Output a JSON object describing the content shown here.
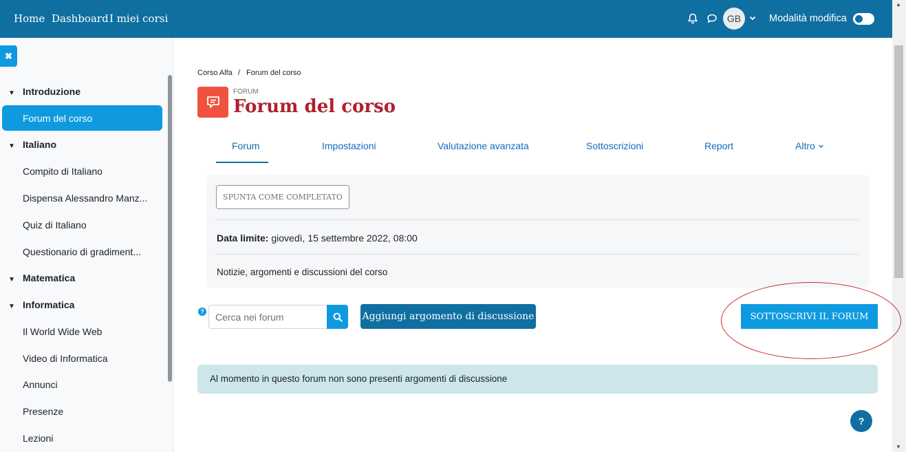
{
  "navbar": {
    "links": [
      "Home",
      "Dashboard",
      "I miei corsi"
    ],
    "avatar_initials": "GB",
    "edit_mode_label": "Modalità modifica",
    "edit_mode_on": false,
    "bg_color": "#0f6fa0"
  },
  "drawer": {
    "items": [
      {
        "type": "section",
        "label": "Introduzione"
      },
      {
        "type": "item",
        "label": "Forum del corso",
        "active": true
      },
      {
        "type": "section",
        "label": "Italiano"
      },
      {
        "type": "item",
        "label": "Compito di Italiano"
      },
      {
        "type": "item",
        "label": "Dispensa Alessandro Manz..."
      },
      {
        "type": "item",
        "label": "Quiz di Italiano"
      },
      {
        "type": "item",
        "label": "Questionario di gradiment..."
      },
      {
        "type": "section",
        "label": "Matematica"
      },
      {
        "type": "section",
        "label": "Informatica"
      },
      {
        "type": "item",
        "label": "Il World Wide Web"
      },
      {
        "type": "item",
        "label": "Video di Informatica"
      },
      {
        "type": "item",
        "label": "Annunci"
      },
      {
        "type": "item",
        "label": "Presenze"
      },
      {
        "type": "item",
        "label": "Lezioni"
      }
    ]
  },
  "breadcrumb": {
    "course": "Corso Alfa",
    "separator": "/",
    "current": "Forum del corso"
  },
  "header": {
    "kind": "FORUM",
    "title": "Forum del corso",
    "title_color": "#b0202c",
    "icon_color": "#f0523f"
  },
  "tabs": [
    "Forum",
    "Impostazioni",
    "Valutazione avanzata",
    "Sottoscrizioni",
    "Report",
    "Altro"
  ],
  "activity": {
    "complete_button": "SPUNTA COME COMPLETATO",
    "due_label": "Data limite:",
    "due_value": "giovedì, 15 settembre 2022, 08:00",
    "description": "Notizie, argomenti e discussioni del corso"
  },
  "actions": {
    "search_placeholder": "Cerca nei forum",
    "add_discussion": "Aggiungi argomento di discussione",
    "subscribe": "SOTTOSCRIVI IL FORUM"
  },
  "alert": {
    "message": "Al momento in questo forum non sono presenti argomenti di discussione"
  },
  "help": {
    "symbol": "?"
  }
}
